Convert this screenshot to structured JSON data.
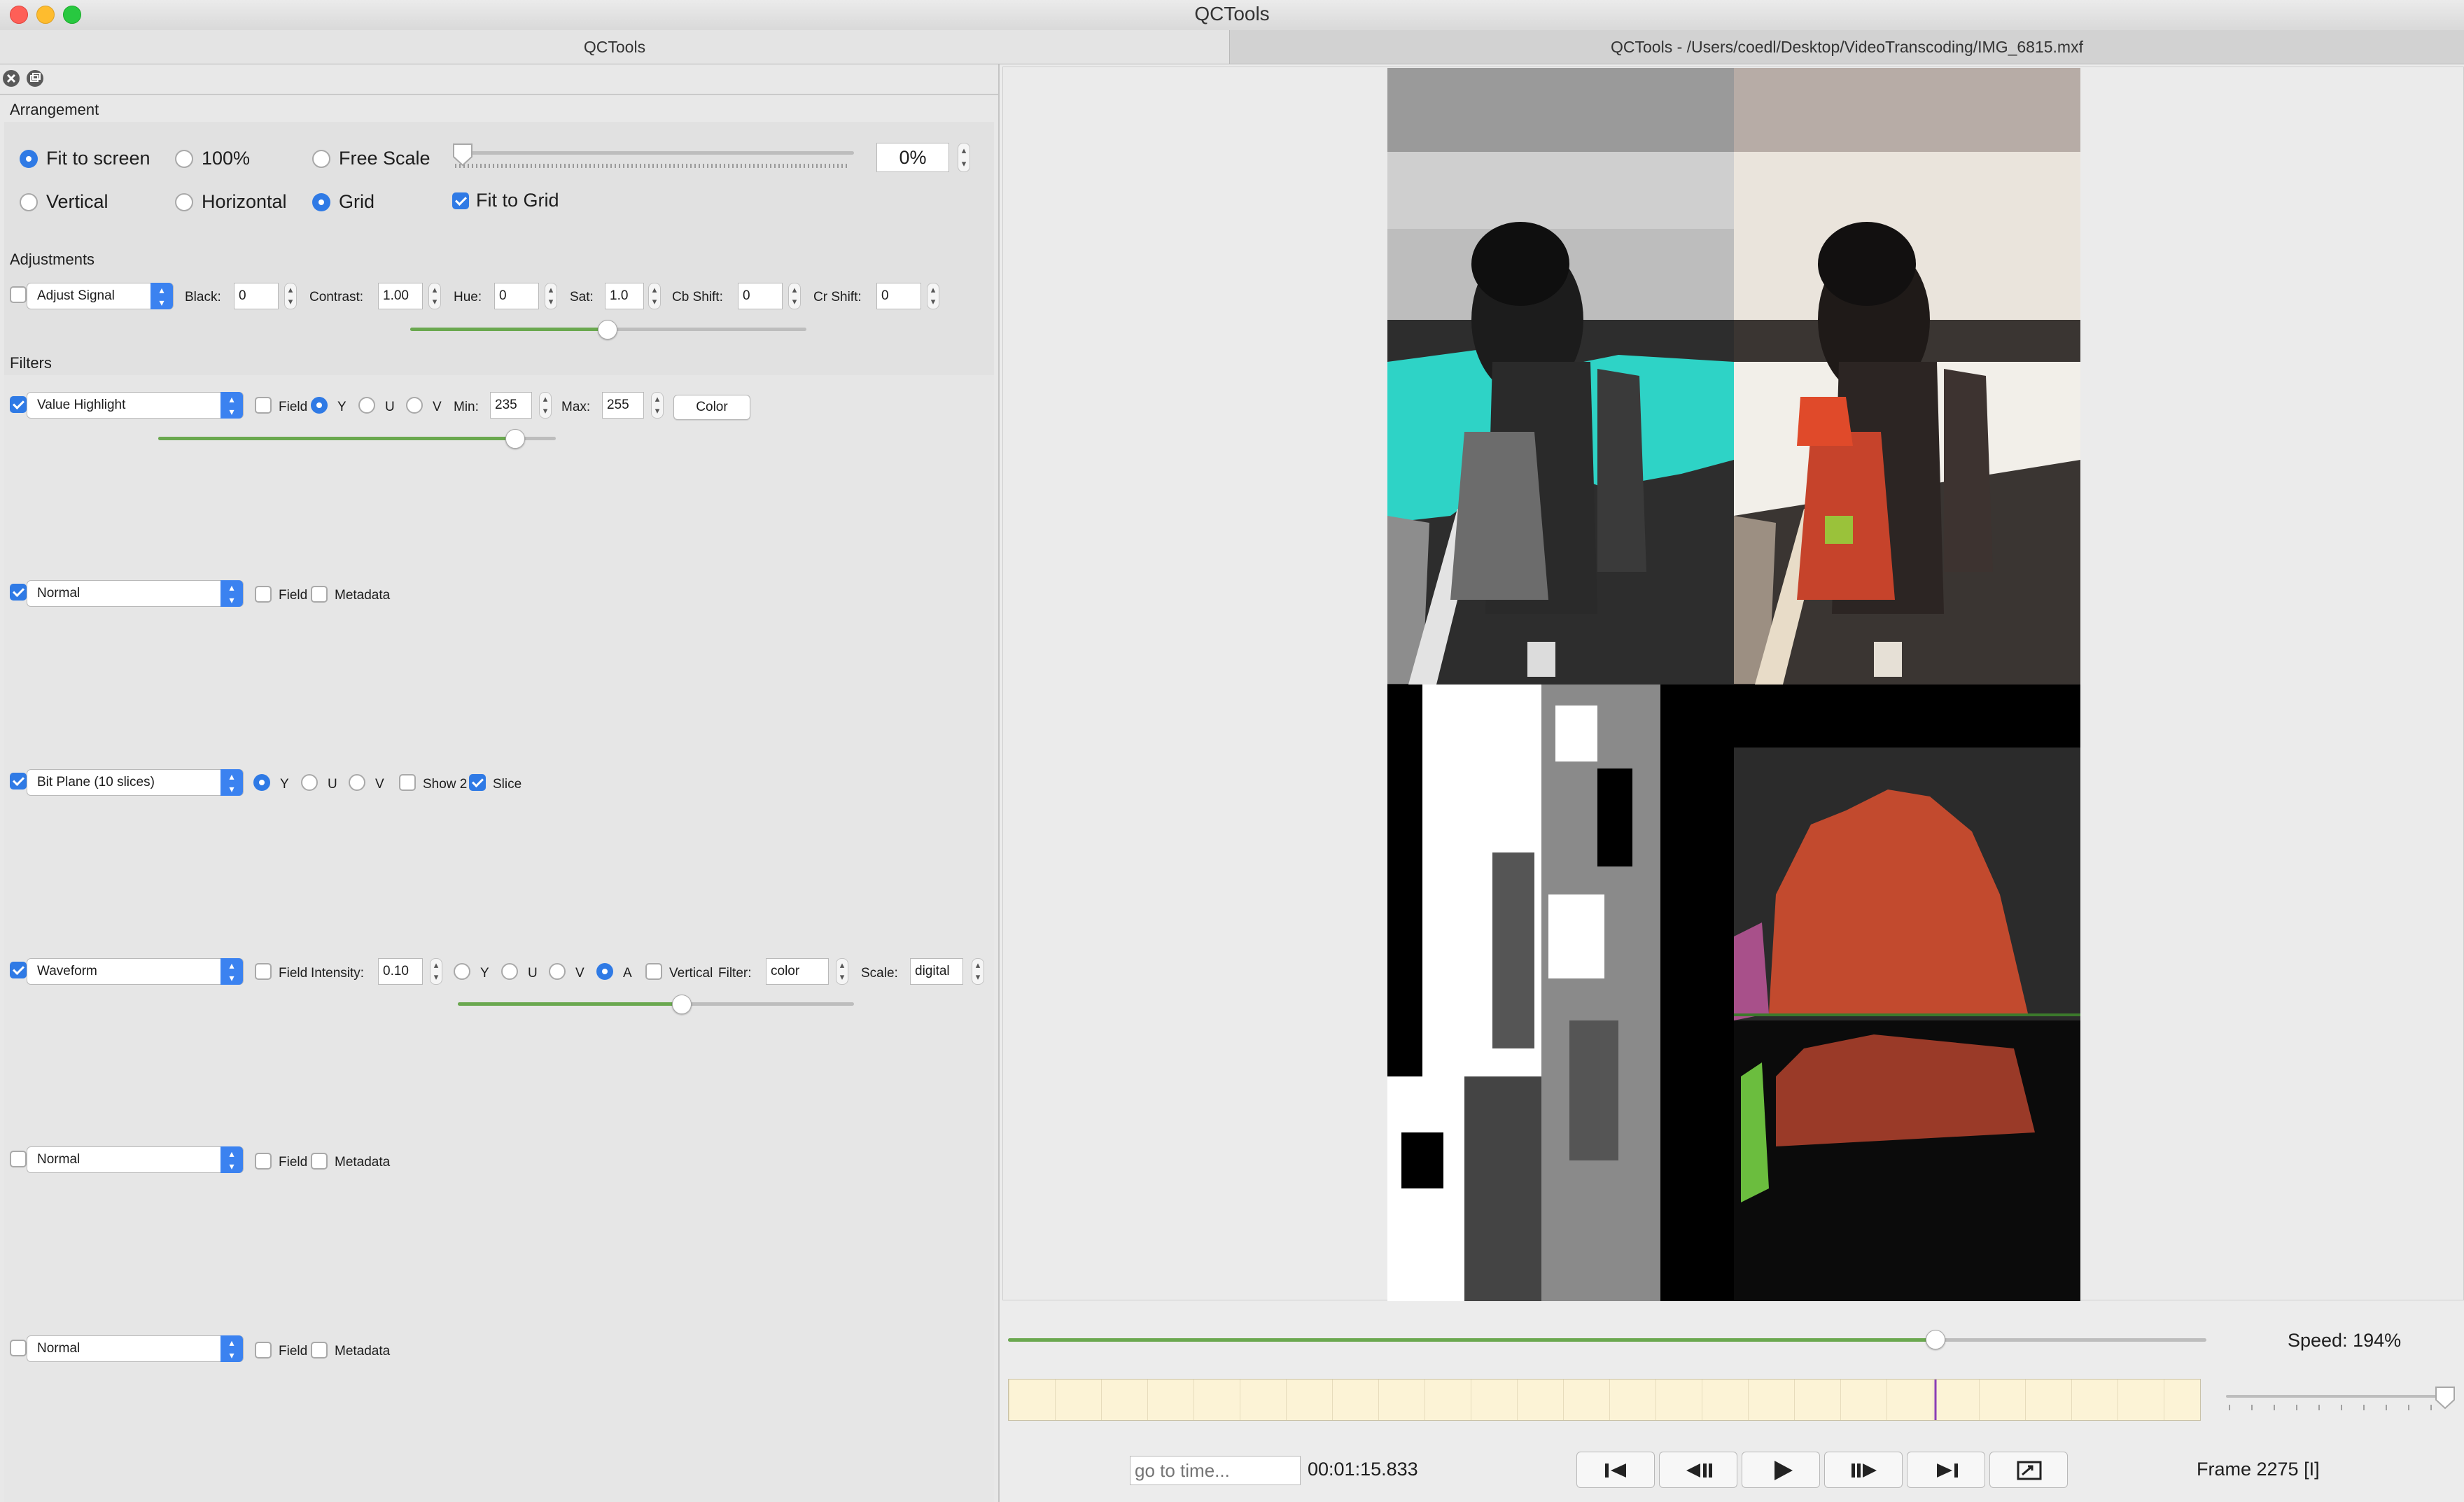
{
  "window": {
    "title": "QCTools",
    "tabs": [
      "QCTools",
      "QCTools - /Users/coedl/Desktop/VideoTranscoding/IMG_6815.mxf"
    ]
  },
  "arrangement": {
    "heading": "Arrangement",
    "options": [
      "Fit to screen",
      "100%",
      "Free Scale",
      "Vertical",
      "Horizontal",
      "Grid"
    ],
    "selected": [
      "Fit to screen",
      "Grid"
    ],
    "fit_to_grid_label": "Fit to Grid",
    "fit_to_grid_checked": true,
    "scale_value": "0%"
  },
  "adjustments": {
    "heading": "Adjustments",
    "combo": "Adjust Signal",
    "enabled": false,
    "black_label": "Black:",
    "black_value": "0",
    "contrast_label": "Contrast:",
    "contrast_value": "1.00",
    "hue_label": "Hue:",
    "hue_value": "0",
    "sat_label": "Sat:",
    "sat_value": "1.0",
    "cb_label": "Cb Shift:",
    "cb_value": "0",
    "cr_label": "Cr Shift:",
    "cr_value": "0",
    "slider_level": 0.5
  },
  "filters": {
    "heading": "Filters",
    "rows": [
      {
        "enabled": true,
        "name": "Value Highlight",
        "field_label": "Field",
        "y": "Y",
        "u": "U",
        "v": "V",
        "min_label": "Min:",
        "min_value": "235",
        "max_label": "Max:",
        "max_value": "255",
        "color_button": "Color",
        "slider_level": 0.92
      },
      {
        "enabled": true,
        "name": "Normal",
        "field_label": "Field",
        "metadata_label": "Metadata"
      },
      {
        "enabled": true,
        "name": "Bit Plane (10 slices)",
        "y": "Y",
        "u": "U",
        "v": "V",
        "show2_label": "Show 2",
        "slice_label": "Slice",
        "slice_checked": true
      },
      {
        "enabled": true,
        "name": "Waveform",
        "field_label": "Field",
        "intensity_label": "Intensity:",
        "intensity_value": "0.10",
        "y": "Y",
        "u": "U",
        "v": "V",
        "a": "A",
        "vertical_label": "Vertical",
        "filter_label": "Filter:",
        "filter_value": "color",
        "scale_label": "Scale:",
        "scale_value": "digital",
        "slider_level": 0.57
      },
      {
        "enabled": false,
        "name": "Normal",
        "field_label": "Field",
        "metadata_label": "Metadata"
      },
      {
        "enabled": false,
        "name": "Normal",
        "field_label": "Field",
        "metadata_label": "Metadata"
      }
    ]
  },
  "playback": {
    "speed_label": "Speed: 194%",
    "speed_slider_level": 0.77,
    "zoom_slider_level": 0.98,
    "goto_placeholder": "go to time...",
    "timecode": "00:01:15.833",
    "frame_label": "Frame 2275 [I]",
    "timeline_position": 0.777,
    "colors": {
      "accent": "#2f7ae5",
      "slider_fill": "#6aa84f",
      "timeline_bg": "#fcf3d6",
      "highlight": "#2ed3c6"
    }
  }
}
